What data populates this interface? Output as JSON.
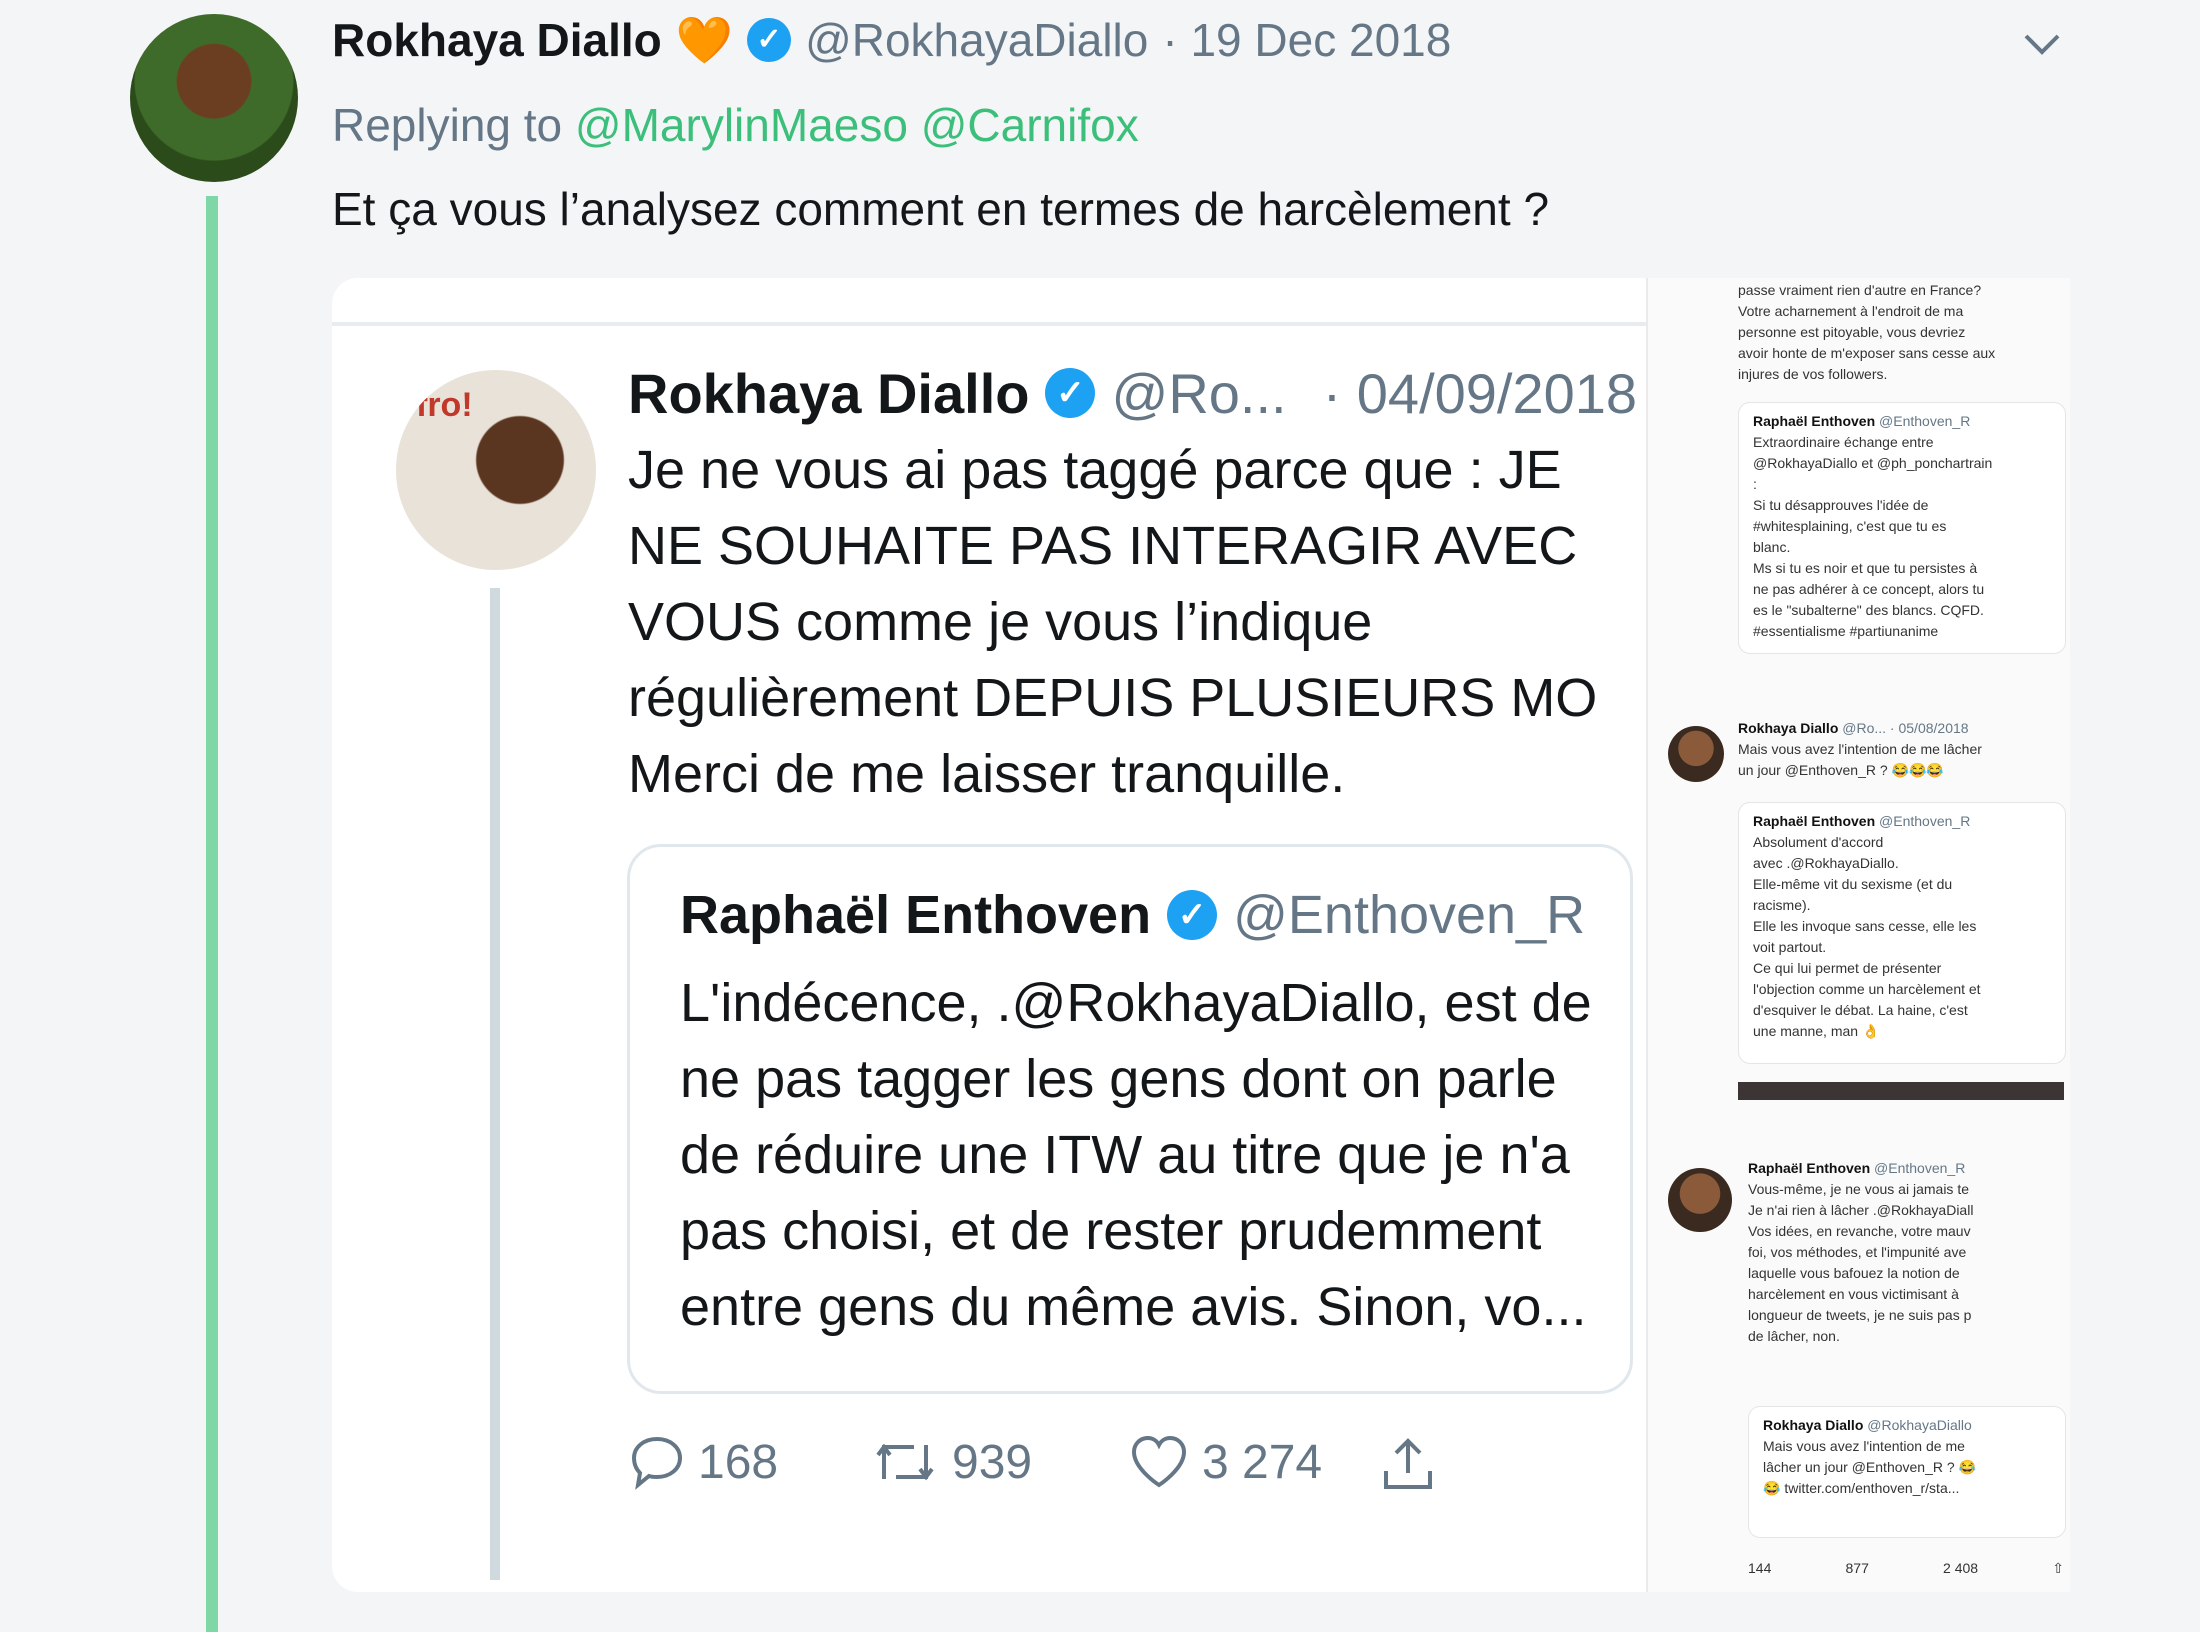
{
  "tweet": {
    "author_name": "Rokhaya Diallo",
    "emoji": "🧡",
    "handle": "@RokhayaDiallo",
    "date": "· 19 Dec 2018",
    "replying_label": "Replying to",
    "reply_to_1": "@MarylinMaeso",
    "reply_to_2": "@Carnifox",
    "text": "Et ça vous l’analysez comment en termes de harcèlement ?",
    "menu_icon": "chevron-down-icon"
  },
  "embedded": {
    "avatar_label": "fro!",
    "author_name": "Rokhaya Diallo",
    "handle": "@Ro...",
    "date": "· 04/09/2018",
    "lines": [
      "Je ne vous ai pas taggé parce que : JE",
      "NE SOUHAITE PAS INTERAGIR AVEC",
      "VOUS comme je vous l’indique",
      "régulièrement DEPUIS PLUSIEURS MO",
      "Merci de me laisser tranquille."
    ],
    "quoted": {
      "author_name": "Raphaël Enthoven",
      "handle": "@Enthoven_R",
      "lines": [
        "L'indécence, .@RokhayaDiallo, est de",
        "ne pas tagger les gens dont on parle",
        "de réduire une ITW au titre que je n'a",
        "pas choisi, et de rester prudemment",
        "entre gens du même avis. Sinon, vo..."
      ]
    },
    "actions": {
      "replies": "168",
      "retweets": "939",
      "likes": "3 274"
    }
  },
  "side": {
    "top_lines": [
      "passe vraiment rien d'autre en France?",
      "Votre acharnement à l'endroit de ma",
      "personne est pitoyable, vous devriez",
      "avoir honte de m'exposer sans cesse aux",
      "injures de vos followers."
    ],
    "box1_name": "Raphaël Enthoven",
    "box1_handle": "@Enthoven_R",
    "box1_lines": [
      "Extraordinaire échange entre",
      "@RokhayaDiallo et @ph_ponchartrain",
      ":",
      "Si tu désapprouves l'idée de",
      "#whitesplaining, c'est que tu es",
      "blanc.",
      "Ms si tu es noir et que tu persistes à",
      "ne pas adhérer à ce concept, alors tu",
      "es le \"subalterne\" des blancs. CQFD.",
      "#essentialisme #partiunanime"
    ],
    "t2_name": "Rokhaya Diallo",
    "t2_meta": "@Ro... · 05/08/2018",
    "t2_lines": [
      "Mais vous avez l'intention de me lâcher",
      "un jour @Enthoven_R ? 😂😂😂"
    ],
    "box2_name": "Raphaël Enthoven",
    "box2_handle": "@Enthoven_R",
    "box2_lines": [
      "Absolument d'accord",
      "avec .@RokhayaDiallo.",
      "Elle-même vit du sexisme (et du",
      "racisme).",
      "Elle les invoque sans cesse, elle les",
      "voit partout.",
      "Ce qui lui permet de présenter",
      "l'objection comme un harcèlement et",
      "d'esquiver le débat. La haine, c'est",
      "une manne, man 👌"
    ],
    "t3_name": "Raphaël Enthoven",
    "t3_handle": "@Enthoven_R",
    "t3_lines": [
      "Vous-même, je ne vous ai jamais te",
      "Je n'ai rien à lâcher .@RokhayaDiall",
      "Vos idées, en revanche, votre mauv",
      "foi, vos méthodes, et l'impunité ave",
      "laquelle vous bafouez la notion de",
      "harcèlement en vous victimisant à",
      "longueur de tweets, je ne suis pas p",
      "de lâcher, non."
    ],
    "box3_name": "Rokhaya Diallo",
    "box3_handle": "@RokhayaDiallo",
    "box3_lines": [
      "Mais vous avez l'intention de me",
      "lâcher un jour @Enthoven_R ? 😂",
      "😂 twitter.com/enthoven_r/sta..."
    ],
    "stats": {
      "replies": "144",
      "retweets": "877",
      "likes": "2 408"
    }
  }
}
